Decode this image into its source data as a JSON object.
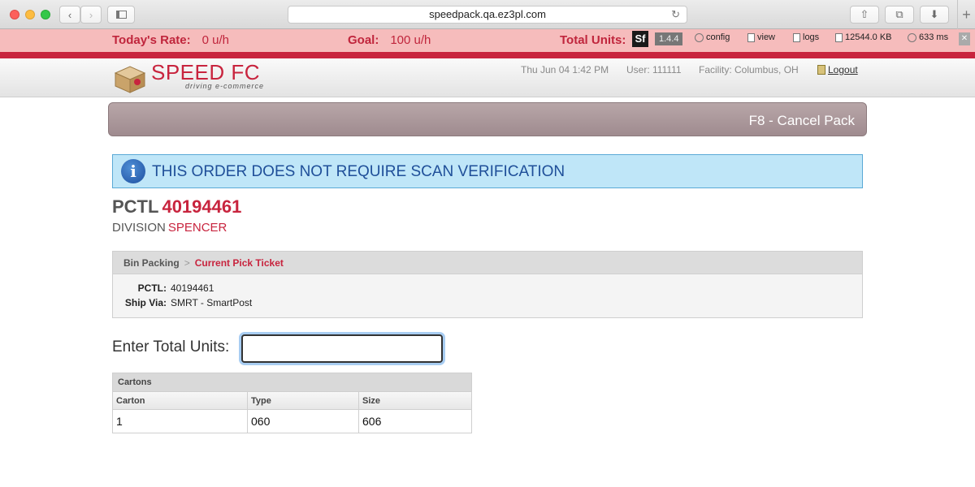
{
  "browser": {
    "url": "speedpack.qa.ez3pl.com"
  },
  "stats": {
    "rate_label": "Today's Rate:",
    "rate_value": "0 u/h",
    "goal_label": "Goal:",
    "goal_value": "100 u/h",
    "total_label": "Total Units:"
  },
  "devbar": {
    "logo": "Sf",
    "version": "1.4.4",
    "config": "config",
    "view": "view",
    "logs": "logs",
    "memory": "12544.0 KB",
    "time": "633 ms"
  },
  "header": {
    "logo_text": "SPEED FC",
    "tagline": "driving e-commerce",
    "datetime": "Thu Jun 04 1:42 PM",
    "user": "User: 111111",
    "facility": "Facility: Columbus, OH",
    "logout": "Logout"
  },
  "toolbar": {
    "cancel_label": "F8 - Cancel Pack"
  },
  "banner": {
    "message": "THIS ORDER DOES NOT REQUIRE SCAN VERIFICATION"
  },
  "order": {
    "pctl_label": "PCTL",
    "pctl_number": "40194461",
    "division_label": "DIVISION",
    "division_value": "SPENCER"
  },
  "breadcrumb": {
    "root": "Bin Packing",
    "separator": ">",
    "current": "Current Pick Ticket"
  },
  "details": {
    "pctl_label": "PCTL:",
    "pctl_value": "40194461",
    "shipvia_label": "Ship Via:",
    "shipvia_value": "SMRT - SmartPost"
  },
  "units": {
    "label": "Enter Total Units:",
    "value": ""
  },
  "cartons": {
    "title": "Cartons",
    "columns": [
      "Carton",
      "Type",
      "Size"
    ],
    "rows": [
      [
        "1",
        "060",
        "606"
      ]
    ]
  }
}
